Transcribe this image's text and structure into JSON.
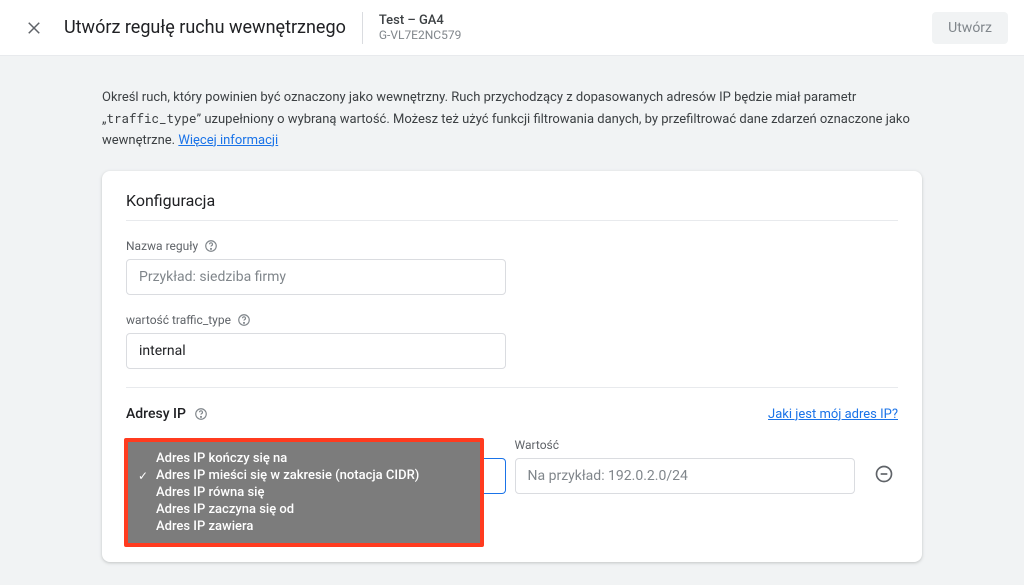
{
  "header": {
    "title": "Utwórz regułę ruchu wewnętrznego",
    "property_name": "Test – GA4",
    "property_id": "G-VL7E2NC579",
    "create_label": "Utwórz"
  },
  "intro": {
    "text_before_code": "Określ ruch, który powinien być oznaczony jako wewnętrzny. Ruch przychodzący z dopasowanych adresów IP będzie miał parametr „",
    "code": "traffic_type",
    "text_after_code": "” uzupełniony o wybraną wartość. Możesz też użyć funkcji filtrowania danych, by przefiltrować dane zdarzeń oznaczone jako wewnętrzne. ",
    "link_text": "Więcej informacji"
  },
  "card": {
    "title": "Konfiguracja",
    "rule_name_label": "Nazwa reguły",
    "rule_name_placeholder": "Przykład: siedziba firmy",
    "rule_name_value": "",
    "traffic_type_label": "wartość traffic_type",
    "traffic_type_value": "internal",
    "ip_section_title": "Adresy IP",
    "ip_help_link": "Jaki jest mój adres IP?",
    "value_label": "Wartość",
    "value_placeholder": "Na przykład: 192.0.2.0/24",
    "value_value": ""
  },
  "match_type_options": [
    {
      "label": "Adres IP kończy się na",
      "selected": false
    },
    {
      "label": "Adres IP mieści się w zakresie (notacja CIDR)",
      "selected": true
    },
    {
      "label": "Adres IP równa się",
      "selected": false
    },
    {
      "label": "Adres IP zaczyna się od",
      "selected": false
    },
    {
      "label": "Adres IP zawiera",
      "selected": false
    }
  ]
}
